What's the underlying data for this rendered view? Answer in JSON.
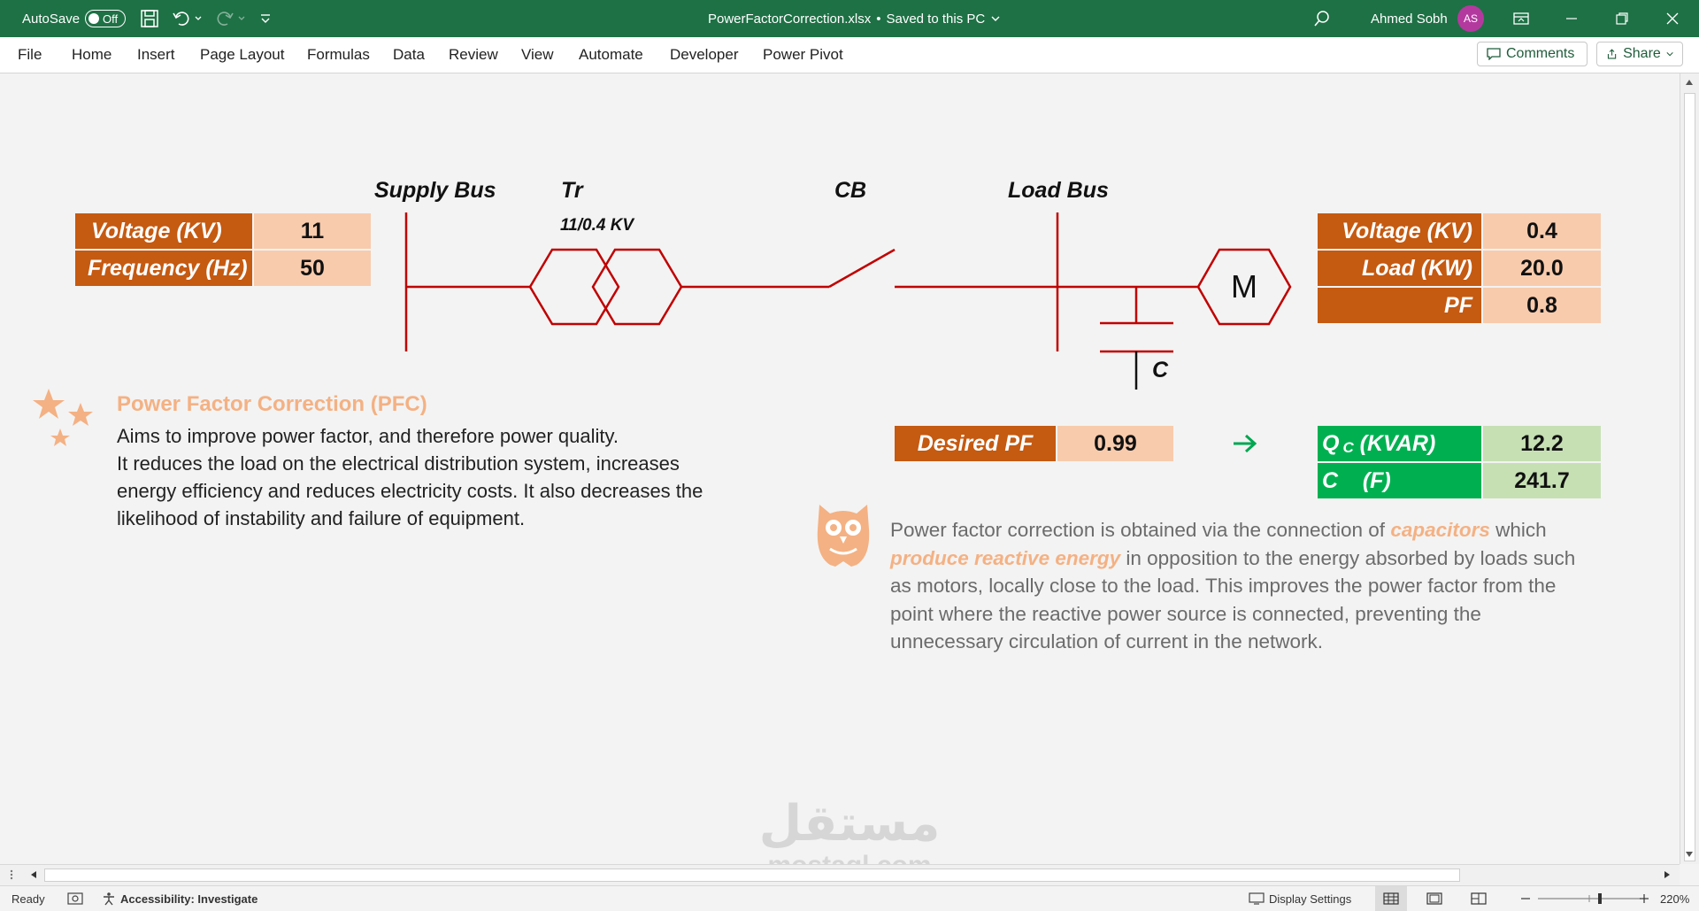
{
  "titlebar": {
    "autosave_label": "AutoSave",
    "autosave_state": "Off",
    "filename": "PowerFactorCorrection.xlsx",
    "save_status": "Saved to this PC",
    "user_name": "Ahmed Sobh",
    "user_initials": "AS",
    "bg_color": "#1e7145"
  },
  "menu": {
    "items": [
      "File",
      "Home",
      "Insert",
      "Page Layout",
      "Formulas",
      "Data",
      "Review",
      "View",
      "Automate",
      "Developer",
      "Power Pivot"
    ],
    "comments_label": "Comments",
    "share_label": "Share"
  },
  "diagram": {
    "supply_bus": "Supply Bus",
    "transformer": "Tr",
    "transformer_rating": "11/0.4 KV",
    "breaker": "CB",
    "load_bus": "Load Bus",
    "motor": "M",
    "capacitor": "C",
    "line_color": "#c00000"
  },
  "supply_table": {
    "rows": [
      {
        "label": "Voltage   (KV)",
        "value": "11"
      },
      {
        "label": "Frequency (Hz)",
        "value": "50"
      }
    ]
  },
  "load_table": {
    "rows": [
      {
        "label": "Voltage (KV)",
        "value": "0.4"
      },
      {
        "label": "Load (KW)",
        "value": "20.0"
      },
      {
        "label": "PF",
        "value": "0.8"
      }
    ]
  },
  "desired": {
    "label": "Desired PF",
    "value": "0.99"
  },
  "result_table": {
    "rows": [
      {
        "label_main": "Q",
        "label_sub": "C",
        "label_rest": " (KVAR)",
        "value": "12.2"
      },
      {
        "label_main": "C    (F)",
        "value": "241.7"
      }
    ]
  },
  "pfc": {
    "title": "Power Factor Correction (PFC)",
    "lines": [
      "Aims to improve power factor, and therefore power quality.",
      "It reduces the load on the electrical distribution system, increases",
      "energy efficiency and reduces electricity costs. It also decreases the",
      "likelihood of instability and failure of equipment."
    ]
  },
  "note": {
    "l1_a": "Power factor correction is obtained via the connection of ",
    "l1_hl": "capacitors",
    "l1_b": " which",
    "l2_hl": "produce reactive energy",
    "l2_b": " in opposition to the energy absorbed by loads such",
    "l3": "as motors, locally close to the load. This improves the power factor from the",
    "l4": "point where the reactive power source is connected, preventing the",
    "l5": "unnecessary circulation of current in the network."
  },
  "watermark": {
    "arabic": "مستقل",
    "latin": "mostaql.com"
  },
  "status": {
    "ready": "Ready",
    "accessibility": "Accessibility: Investigate",
    "display_settings": "Display Settings",
    "zoom": "220%"
  },
  "colors": {
    "label_orange": "#c55a11",
    "value_peach": "#f8cbad",
    "label_green": "#00b050",
    "value_green": "#c6e0b4",
    "accent_peach": "#f4b183"
  }
}
